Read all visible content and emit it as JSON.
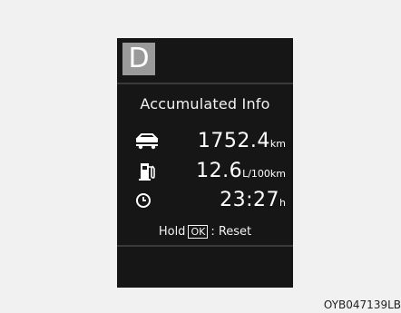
{
  "gear": "D",
  "title": "Accumulated Info",
  "distance": {
    "value": "1752.4",
    "unit": "km",
    "icon": "car-icon"
  },
  "fuel": {
    "value": "12.6",
    "unit": "L/100km",
    "icon": "fuel-pump-icon"
  },
  "time": {
    "value": "23:27",
    "unit": "h",
    "icon": "clock-icon"
  },
  "reset": {
    "prefix": "Hold",
    "key": "OK",
    "suffix": ": Reset"
  },
  "code": "OYB047139LB",
  "colors": {
    "background": "#f1f1f1",
    "panel": "#161616",
    "gear_box": "#9a9a9a",
    "text": "#ffffff"
  }
}
